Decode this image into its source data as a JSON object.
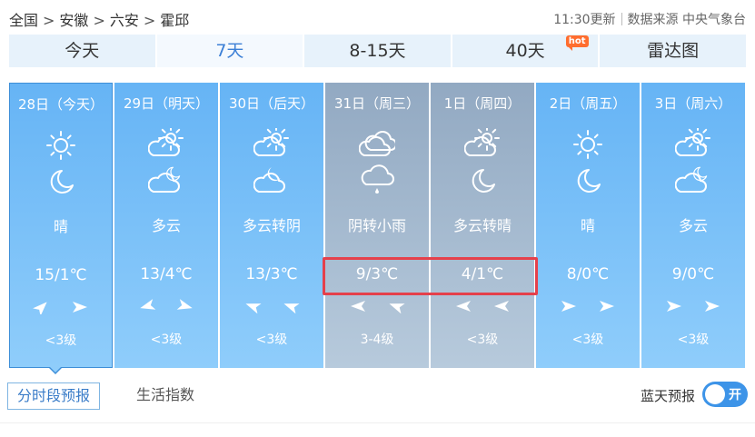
{
  "breadcrumb": [
    "全国",
    "安徽",
    "六安",
    "霍邱"
  ],
  "breadcrumb_separator": ">",
  "update_time": "11:30更新",
  "data_source": "数据来源 中央气象台",
  "tabs": [
    {
      "label": "今天",
      "active": false
    },
    {
      "label": "7天",
      "active": true
    },
    {
      "label": "8-15天",
      "active": false
    },
    {
      "label": "40天",
      "active": false,
      "badge": "hot"
    },
    {
      "label": "雷达图",
      "active": false
    }
  ],
  "days": [
    {
      "date": "28日（今天）",
      "day_icon": "sun-icon",
      "night_icon": "moon-icon",
      "desc": "晴",
      "temp": "15/1℃",
      "wind_icons": [
        "wind-arrow-icon",
        "wind-arrow-icon"
      ],
      "level": "<3级"
    },
    {
      "date": "29日（明天）",
      "day_icon": "partly-cloudy-icon",
      "night_icon": "cloudy-night-icon",
      "desc": "多云",
      "temp": "13/4℃",
      "wind_icons": [
        "wind-arrow-icon",
        "wind-arrow-icon"
      ],
      "level": "<3级"
    },
    {
      "date": "30日（后天）",
      "day_icon": "partly-cloudy-icon",
      "night_icon": "partly-cloudy-night-icon",
      "desc": "多云转阴",
      "temp": "13/3℃",
      "wind_icons": [
        "wind-arrow-icon",
        "wind-arrow-icon"
      ],
      "level": "<3级"
    },
    {
      "date": "31日（周三）",
      "day_icon": "overcast-icon",
      "night_icon": "light-rain-icon",
      "desc": "阴转小雨",
      "temp": "9/3℃",
      "wind_icons": [
        "wind-arrow-icon",
        "wind-arrow-icon"
      ],
      "level": "3-4级"
    },
    {
      "date": "1日（周四）",
      "day_icon": "partly-cloudy-icon",
      "night_icon": "moon-icon",
      "desc": "多云转晴",
      "temp": "4/1℃",
      "wind_icons": [
        "wind-arrow-icon",
        "wind-arrow-icon"
      ],
      "level": "<3级"
    },
    {
      "date": "2日（周五）",
      "day_icon": "sun-icon",
      "night_icon": "moon-icon",
      "desc": "晴",
      "temp": "8/0℃",
      "wind_icons": [
        "wind-arrow-icon",
        "wind-arrow-icon"
      ],
      "level": "<3级"
    },
    {
      "date": "3日（周六）",
      "day_icon": "partly-cloudy-icon",
      "night_icon": "cloudy-night-icon",
      "desc": "多云",
      "temp": "9/0℃",
      "wind_icons": [
        "wind-arrow-icon",
        "wind-arrow-icon"
      ],
      "level": "<3级"
    }
  ],
  "bottom": {
    "hourly_tab": "分时段预报",
    "life_index_tab": "生活指数",
    "blue_sky_label": "蓝天预报",
    "toggle_label": "开"
  },
  "colors": {
    "day_bg": "#66b4f5",
    "rain_bg": "#92a9c2",
    "highlight": "#e5404b",
    "active_tab_text": "#3b7fd6"
  }
}
